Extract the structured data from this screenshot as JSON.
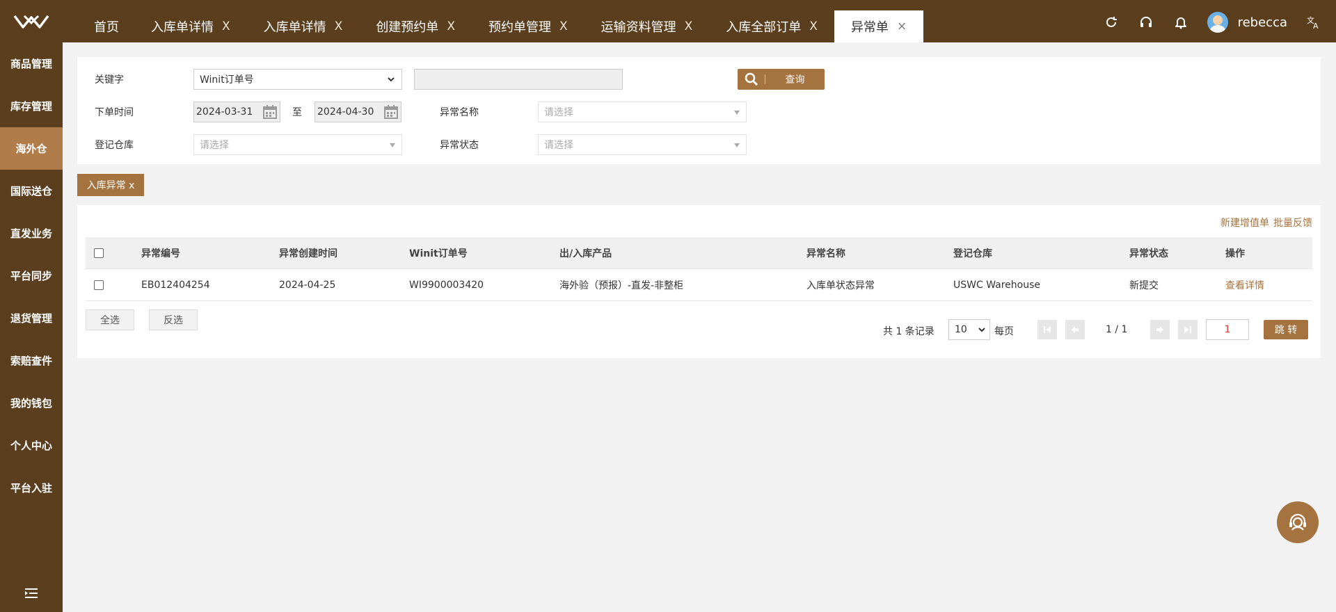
{
  "colors": {
    "brand_dark": "#5a3e1d",
    "brand_accent": "#a5733f",
    "sidebar_active": "#b07c4a"
  },
  "tabs": [
    {
      "label": "首页",
      "closable": false
    },
    {
      "label": "入库单详情",
      "closable": true
    },
    {
      "label": "入库单详情",
      "closable": true
    },
    {
      "label": "创建预约单",
      "closable": true
    },
    {
      "label": "预约单管理",
      "closable": true
    },
    {
      "label": "运输资料管理",
      "closable": true
    },
    {
      "label": "入库全部订单",
      "closable": true
    },
    {
      "label": "异常单",
      "closable": true,
      "active": true
    }
  ],
  "tab_close_glyph": "X",
  "tab_close_glyph_active": "×",
  "header": {
    "username": "rebecca",
    "icons": [
      "refresh-icon",
      "headset-icon",
      "bell-icon",
      "avatar",
      "translate-icon"
    ]
  },
  "sidebar": {
    "items": [
      {
        "label": "商品管理"
      },
      {
        "label": "库存管理"
      },
      {
        "label": "海外仓",
        "active": true
      },
      {
        "label": "国际送仓"
      },
      {
        "label": "直发业务"
      },
      {
        "label": "平台同步"
      },
      {
        "label": "退货管理"
      },
      {
        "label": "索赔查件"
      },
      {
        "label": "我的钱包"
      },
      {
        "label": "个人中心"
      },
      {
        "label": "平台入驻"
      }
    ]
  },
  "filters": {
    "keyword_label": "关键字",
    "keyword_type": "Winit订单号",
    "keyword_value": "",
    "query_label": "查询",
    "order_time_label": "下单时间",
    "date_from": "2024-03-31",
    "date_sep": "至",
    "date_to": "2024-04-30",
    "exception_name_label": "异常名称",
    "exception_name_placeholder": "请选择",
    "warehouse_label": "登记仓库",
    "warehouse_placeholder": "请选择",
    "exception_status_label": "异常状态",
    "exception_status_placeholder": "请选择"
  },
  "active_chip": "入库异常 x",
  "actions": {
    "new_value_added": "新建增值单",
    "batch_feedback": "批量反馈"
  },
  "table": {
    "columns": [
      "异常编号",
      "异常创建时间",
      "Winit订单号",
      "出/入库产品",
      "异常名称",
      "登记仓库",
      "异常状态",
      "操作"
    ],
    "rows": [
      {
        "exception_no": "EB012404254",
        "created": "2024-04-25",
        "winit_no": "WI9900003420",
        "product": "海外验（预报）-直发-非整柜",
        "exception_name": "入库单状态异常",
        "warehouse": "USWC Warehouse",
        "status": "新提交",
        "action": "查看详情"
      }
    ]
  },
  "bulk": {
    "select_all": "全选",
    "invert": "反选"
  },
  "pagination": {
    "total_text": "共 1 条记录",
    "page_size": "10",
    "per_page": "每页",
    "page_info": "1 / 1",
    "jump_value": "1",
    "jump_label": "跳 转"
  }
}
